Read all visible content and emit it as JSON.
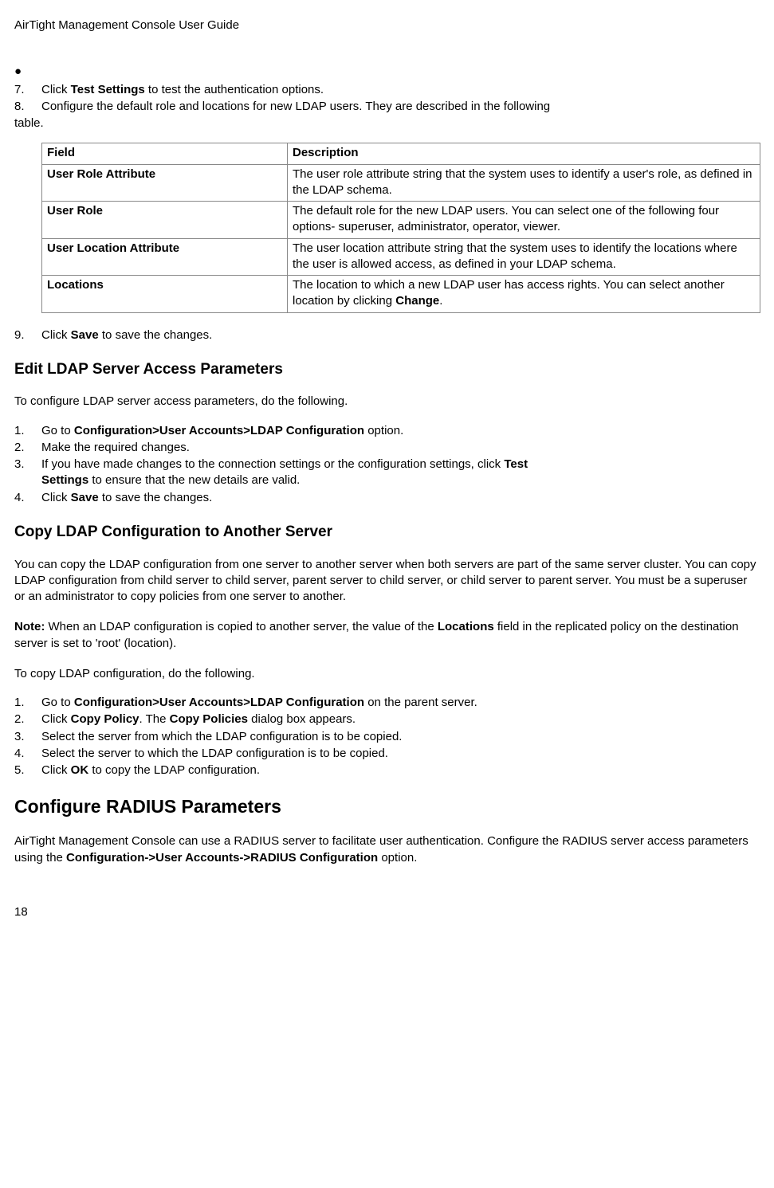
{
  "header": {
    "title": "AirTight Management Console User Guide"
  },
  "list1": {
    "item7": {
      "num": "7.",
      "pre": "Click ",
      "bold": "Test Settings",
      "post": " to test the authentication options."
    },
    "item8": {
      "num": "8.",
      "text": "Configure the default role and locations for new LDAP users. They are described in the following",
      "cont": "table."
    }
  },
  "table": {
    "h1": "Field",
    "h2": "Description",
    "rows": [
      {
        "f": "User Role Attribute",
        "d": "The user role attribute string that the system uses to identify a user's role, as defined in the LDAP schema."
      },
      {
        "f": "User Role",
        "d": "The default role for the new LDAP users. You can select one of the following four options- superuser, administrator, operator, viewer."
      },
      {
        "f": "User Location Attribute",
        "d": "The user location attribute string that the system uses to identify the locations where the user is allowed access, as defined in your LDAP schema."
      },
      {
        "f": "Locations",
        "d_pre": " The location to which a new LDAP user has access rights. You can select another location by clicking ",
        "d_bold": "Change",
        "d_post": "."
      }
    ]
  },
  "list2": {
    "item9": {
      "num": "9.",
      "pre": "Click ",
      "bold": "Save",
      "post": " to save the changes."
    }
  },
  "sec1": {
    "title": "Edit LDAP Server Access Parameters",
    "intro": "To configure LDAP server access parameters, do the following.",
    "items": {
      "i1": {
        "num": "1.",
        "pre": "Go to ",
        "bold": "Configuration>User Accounts>LDAP Configuration",
        "post": " option."
      },
      "i2": {
        "num": "2.",
        "text": "Make the required changes."
      },
      "i3": {
        "num": "3.",
        "pre": "If you have made changes to the connection settings or the configuration settings, click ",
        "bold": "Test",
        "line2_bold": "Settings",
        "line2_post": " to ensure that the new details are valid."
      },
      "i4": {
        "num": "4.",
        "pre": "Click ",
        "bold": "Save",
        "post": " to save the changes."
      }
    }
  },
  "sec2": {
    "title": "Copy LDAP Configuration to Another Server",
    "para1": "You can copy the LDAP configuration from one server to another server when both servers are part of the same server cluster. You can copy LDAP configuration from child server to child server, parent server to child server, or child server to parent server. You must be a superuser or an administrator to copy policies from one server to another.",
    "note_label": "Note:",
    "note_pre": " When an LDAP configuration is copied to another server, the value of the ",
    "note_bold": "Locations",
    "note_post": " field in the replicated policy on the destination server is set to 'root' (location).",
    "intro2": "To copy LDAP configuration, do the following.",
    "items": {
      "i1": {
        "num": "1.",
        "pre": "Go to ",
        "bold": "Configuration>User Accounts>LDAP Configuration",
        "post": " on the parent server."
      },
      "i2": {
        "num": "2.",
        "pre": "Click ",
        "bold1": "Copy Policy",
        "mid": ". The ",
        "bold2": "Copy Policies",
        "post": " dialog box appears."
      },
      "i3": {
        "num": "3.",
        "text": "Select the server from which the LDAP configuration is to be copied."
      },
      "i4": {
        "num": "4.",
        "text": "Select the server to which the LDAP configuration is to be copied."
      },
      "i5": {
        "num": "5.",
        "pre": "Click ",
        "bold": "OK",
        "post": " to copy the LDAP configuration."
      }
    }
  },
  "sec3": {
    "title": "Configure RADIUS Parameters",
    "para_pre": "AirTight Management Console can use a RADIUS server to facilitate user authentication. Configure the RADIUS server access parameters using the ",
    "para_bold": "Configuration->User Accounts->RADIUS Configuration",
    "para_post": " option."
  },
  "footer": {
    "pagenum": "18"
  }
}
